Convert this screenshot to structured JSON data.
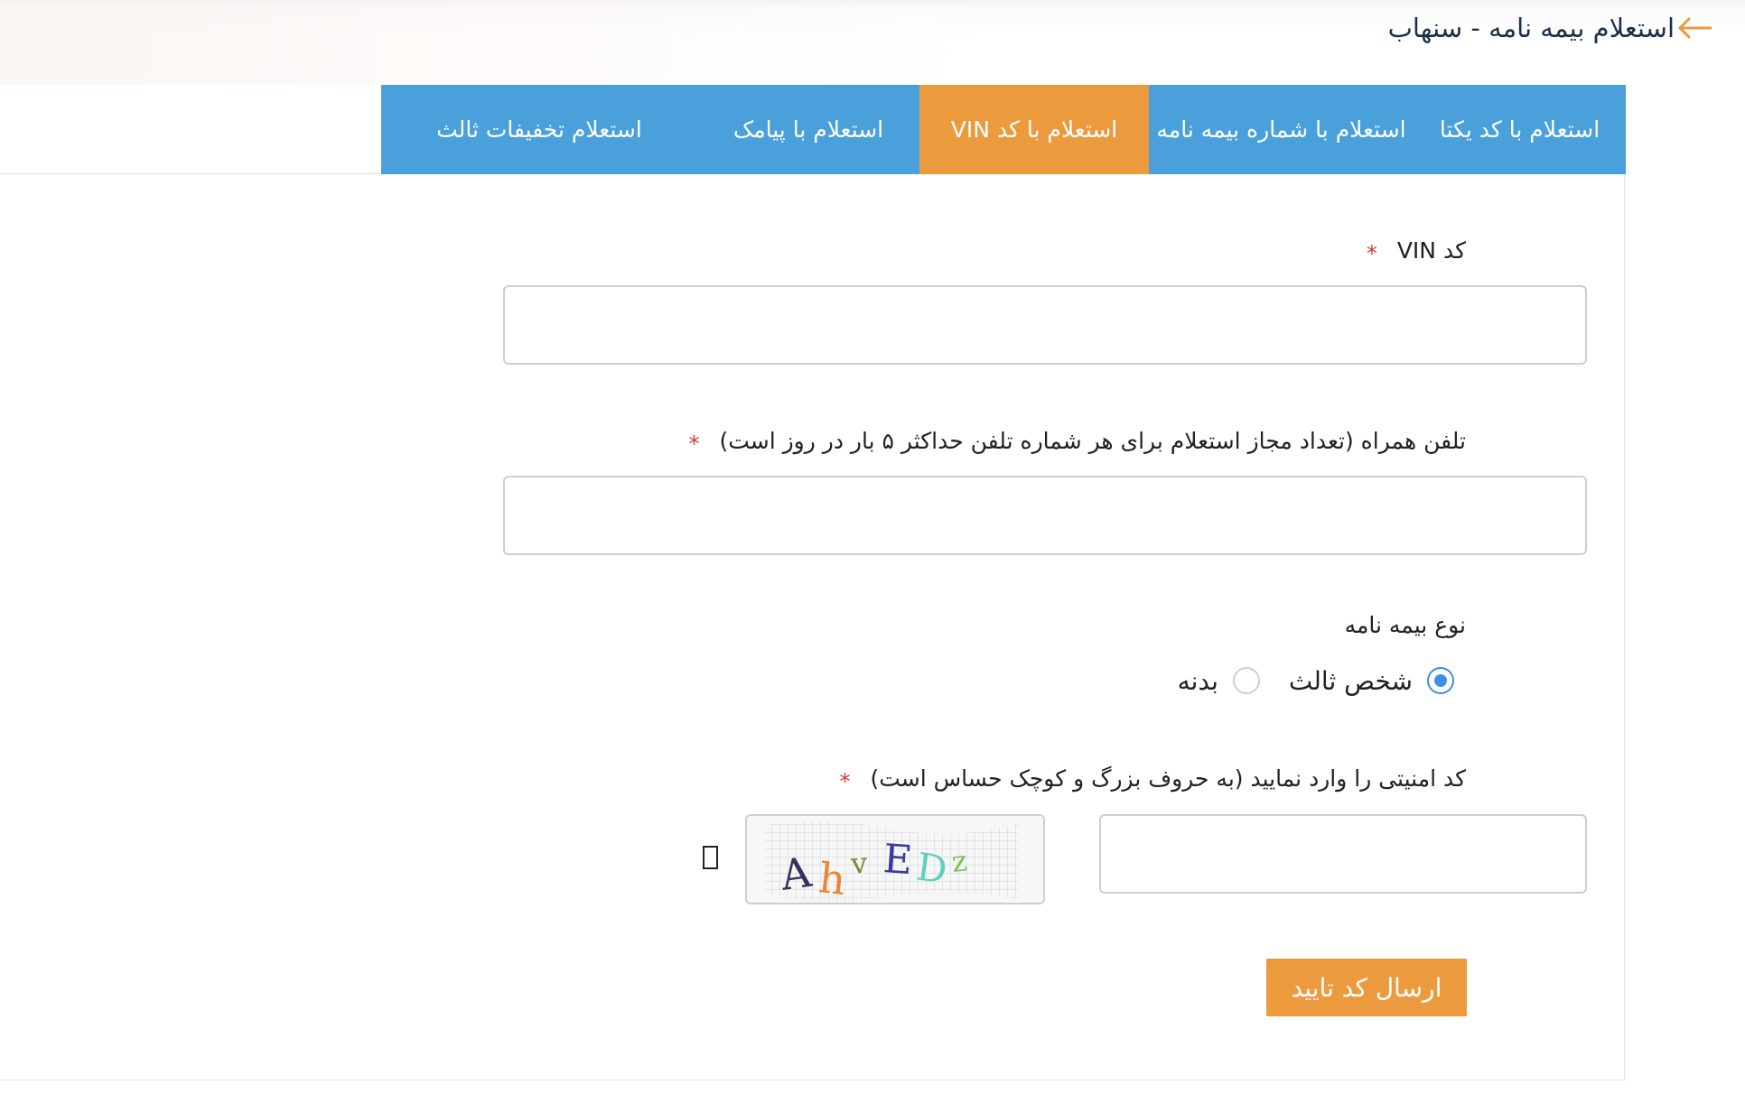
{
  "header": {
    "title": "استعلام بیمه نامه - سنهاب",
    "back_icon": "arrow-left-icon",
    "accent_color": "#ec9a3e"
  },
  "tabs": [
    {
      "label": "استعلام با کد یکتا",
      "active": false
    },
    {
      "label": "استعلام با شماره بیمه نامه",
      "active": false
    },
    {
      "label": "استعلام با کد VIN",
      "active": true
    },
    {
      "label": "استعلام با پیامک",
      "active": false
    },
    {
      "label": "استعلام تخفیفات ثالث",
      "active": false
    }
  ],
  "tab_colors": {
    "default": "#4aa0db",
    "active": "#ec9a3e"
  },
  "form": {
    "vin": {
      "label": "کد VIN",
      "required_mark": "*",
      "value": ""
    },
    "mobile": {
      "label": "تلفن همراه (تعداد مجاز استعلام برای هر شماره تلفن حداکثر ۵ بار در روز است)",
      "required_mark": "*",
      "value": ""
    },
    "policy_type": {
      "label": "نوع بیمه نامه",
      "options": [
        {
          "label": "شخص ثالث",
          "checked": true
        },
        {
          "label": "بدنه",
          "checked": false
        }
      ]
    },
    "captcha": {
      "label": "کد امنیتی را وارد نمایید (به حروف بزرگ و کوچک حساس است)",
      "required_mark": "*",
      "value": "",
      "image_text": "AhvEDz"
    },
    "submit_label": "ارسال کد تایید"
  }
}
